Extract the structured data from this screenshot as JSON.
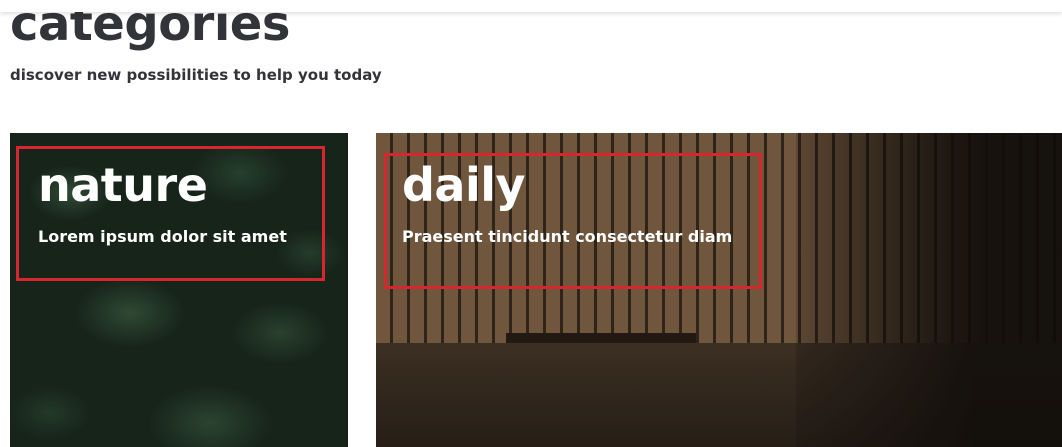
{
  "section": {
    "title": "categories",
    "subtitle": "discover new possibilities to help you today"
  },
  "cards": [
    {
      "title": "nature",
      "text": "Lorem ipsum dolor sit amet"
    },
    {
      "title": "daily",
      "text": "Praesent tincidunt consectetur diam"
    }
  ],
  "colors": {
    "heading": "#33333a",
    "highlight_border": "#d6262e",
    "card_text": "#ffffff"
  }
}
